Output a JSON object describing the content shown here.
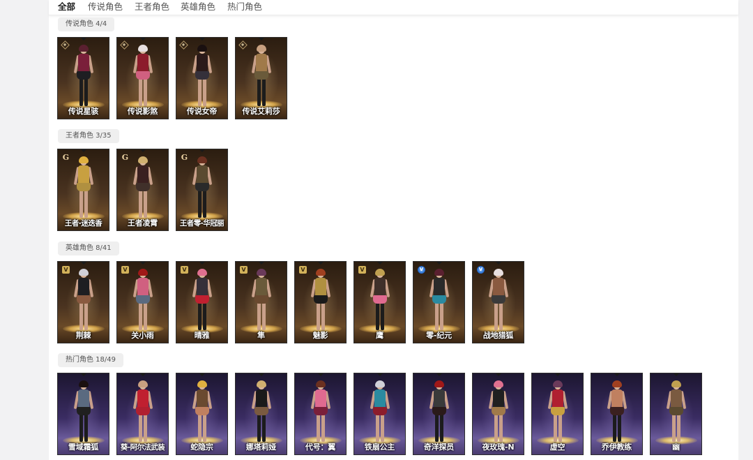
{
  "tabs": [
    {
      "label": "全部",
      "active": true
    },
    {
      "label": "传说角色",
      "active": false
    },
    {
      "label": "王者角色",
      "active": false
    },
    {
      "label": "英雄角色",
      "active": false
    },
    {
      "label": "热门角色",
      "active": false
    }
  ],
  "sections": [
    {
      "label": "传说角色 4/4",
      "theme": "gold",
      "badge": "legend",
      "cards": [
        {
          "name": "传说星骇"
        },
        {
          "name": "传说影煞"
        },
        {
          "name": "传说女帝"
        },
        {
          "name": "传说艾莉莎"
        }
      ]
    },
    {
      "label": "王者角色 3/35",
      "theme": "gold",
      "badge": "king",
      "cards": [
        {
          "name": "王者-迷迭香"
        },
        {
          "name": "王者凌霄"
        },
        {
          "name": "王者零-华冠丽"
        }
      ]
    },
    {
      "label": "英雄角色 8/41",
      "theme": "gold",
      "badge": "hero",
      "cards": [
        {
          "name": "荆棘"
        },
        {
          "name": "关小雨"
        },
        {
          "name": "晴雅"
        },
        {
          "name": "隼"
        },
        {
          "name": "魅影"
        },
        {
          "name": "鹰"
        },
        {
          "name": "零-纪元",
          "badge": "blue"
        },
        {
          "name": "战地猎狐",
          "badge": "blue"
        }
      ]
    },
    {
      "label": "热门角色 18/49",
      "theme": "purple",
      "badge": "",
      "cards": [
        {
          "name": "雪域霜狐"
        },
        {
          "name": "葵-阿尔法武装"
        },
        {
          "name": "蛇隐宗"
        },
        {
          "name": "娜塔莉娅"
        },
        {
          "name": "代号：翼"
        },
        {
          "name": "铁扇公主"
        },
        {
          "name": "奇洋探员"
        },
        {
          "name": "夜玫瑰-N"
        },
        {
          "name": "虚空"
        },
        {
          "name": "乔伊教练"
        },
        {
          "name": "幽"
        }
      ]
    }
  ],
  "badge_glyphs": {
    "legend": "◈",
    "king": "G",
    "hero": "V",
    "blue": "V"
  },
  "colors": {
    "outfits": [
      "#7a1f3a",
      "#8c1c2c",
      "#2a1a1a",
      "#a07a4a",
      "#c8a040",
      "#3a2020",
      "#5a4a30",
      "#1e1e22",
      "#d06080",
      "#35303a",
      "#6a5a3a",
      "#b09040",
      "#40302a",
      "#2a2a2a",
      "#8a5a40",
      "#5a6a80",
      "#c02030",
      "#6a4a30",
      "#1a1a1a",
      "#e06a90",
      "#2a8aa0",
      "#3a3a3a",
      "#202020",
      "#b02030",
      "#c08060",
      "#7a5a40"
    ],
    "hair": [
      "#5a2030",
      "#e8e0e0",
      "#1a1010",
      "#c8a080",
      "#e0b040",
      "#d0b070",
      "#6a3020",
      "#d0d0d8",
      "#a01818",
      "#e07090",
      "#6a3a5a",
      "#a04020",
      "#c0a050"
    ]
  }
}
